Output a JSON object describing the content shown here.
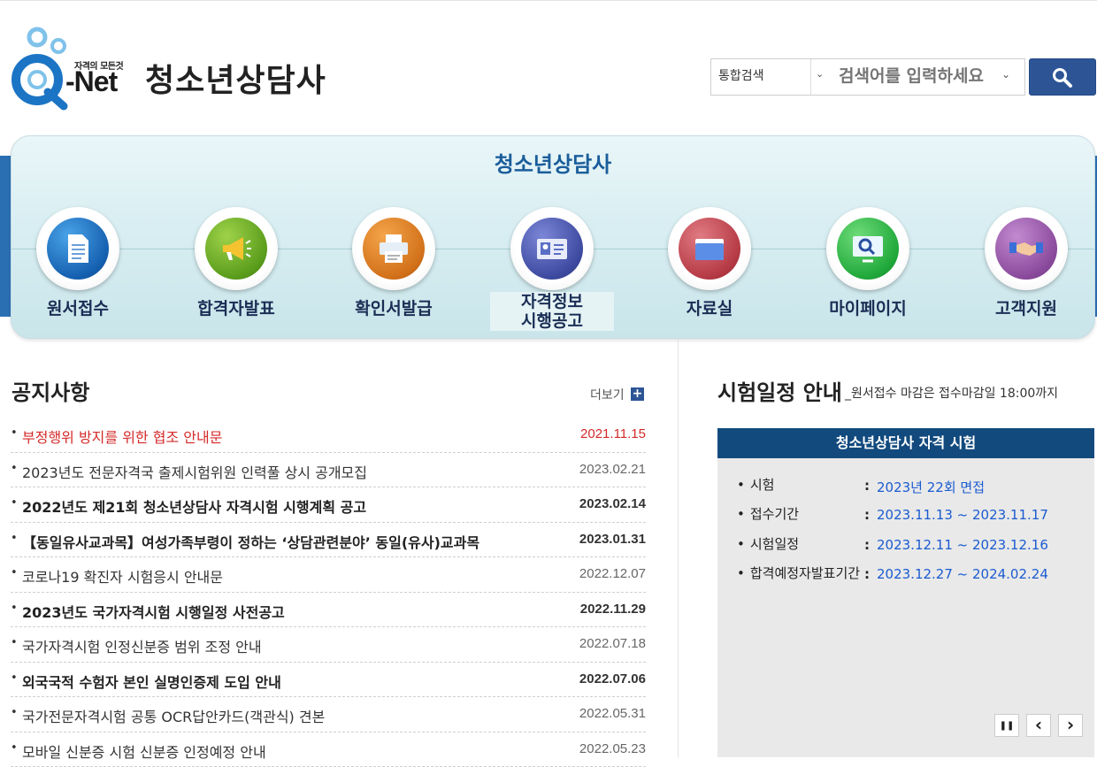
{
  "header": {
    "logo_slogan": "자격의 모든것",
    "logo_text": "-Net",
    "site_title": "청소년상담사",
    "search": {
      "category": "통합검색",
      "placeholder": "검색어를 입력하세요"
    }
  },
  "menu": {
    "title": "청소년상담사",
    "items": [
      {
        "label": "원서접수",
        "icon": "document-icon"
      },
      {
        "label": "합격자발표",
        "icon": "megaphone-icon"
      },
      {
        "label": "확인서발급",
        "icon": "printer-icon"
      },
      {
        "label_line1": "자격정보",
        "label_line2": "시행공고",
        "icon": "id-card-icon"
      },
      {
        "label": "자료실",
        "icon": "folder-icon"
      },
      {
        "label": "마이페이지",
        "icon": "monitor-search-icon"
      },
      {
        "label": "고객지원",
        "icon": "handshake-icon"
      }
    ]
  },
  "notice": {
    "title": "공지사항",
    "more_label": "더보기",
    "items": [
      {
        "title": "부정행위 방지를 위한 협조 안내문",
        "date": "2021.11.15",
        "style": "red"
      },
      {
        "title": "2023년도 전문자격국 출제시험위원 인력풀 상시 공개모집",
        "date": "2023.02.21",
        "style": "normal"
      },
      {
        "title": "2022년도 제21회 청소년상담사 자격시험 시행계획 공고",
        "date": "2023.02.14",
        "style": "bold"
      },
      {
        "title": "【동일유사교과목】여성가족부령이 정하는 ‘상담관련분야’ 동일(유사)교과목",
        "date": "2023.01.31",
        "style": "bold"
      },
      {
        "title": "코로나19 확진자 시험응시 안내문",
        "date": "2022.12.07",
        "style": "normal"
      },
      {
        "title": "2023년도 국가자격시험 시행일정 사전공고",
        "date": "2022.11.29",
        "style": "bold"
      },
      {
        "title": "국가자격시험 인정신분증 범위 조정 안내",
        "date": "2022.07.18",
        "style": "normal"
      },
      {
        "title": "외국국적 수험자 본인 실명인증제 도입 안내",
        "date": "2022.07.06",
        "style": "bold"
      },
      {
        "title": "국가전문자격시험 공통 OCR답안카드(객관식) 견본",
        "date": "2022.05.31",
        "style": "normal"
      },
      {
        "title": "모바일 신분증 시험 신분증 인정예정 안내",
        "date": "2022.05.23",
        "style": "normal"
      }
    ]
  },
  "schedule": {
    "title": "시험일정 안내",
    "subtitle": "_원서접수 마감은 접수마감일 18:00까지",
    "box_title": "청소년상담사 자격 시험",
    "rows": [
      {
        "key": "시험",
        "value": "2023년 22회 면접"
      },
      {
        "key": "접수기간",
        "value": "2023.11.13 ~ 2023.11.17"
      },
      {
        "key": "시험일정",
        "value": "2023.12.11 ~ 2023.12.16"
      },
      {
        "key": "합격예정자발표기간",
        "value": "2023.12.27 ~ 2024.02.24"
      }
    ],
    "controls": {
      "pause": "❚❚",
      "prev": "‹",
      "next": "›"
    }
  }
}
